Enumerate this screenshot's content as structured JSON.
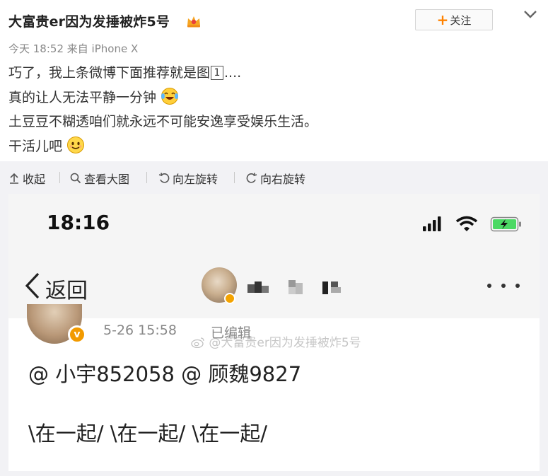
{
  "post": {
    "username": "大富贵er因为发捶被炸5号",
    "follow_label": "关注",
    "follow_plus": "+",
    "time": "今天 18:52",
    "source": "来自 iPhone X",
    "lines": {
      "line1_before": "巧了，我上条微博下面推荐就是图",
      "line1_boxed": "1",
      "line1_after": "....",
      "line2": "真的让人无法平静一分钟",
      "line3": "土豆豆不糊透咱们就永远不可能安逸享受娱乐生活。",
      "line4": "干活儿吧"
    }
  },
  "toolbar": {
    "collapse": "收起",
    "view_large": "查看大图",
    "rotate_left": "向左旋转",
    "rotate_right": "向右旋转"
  },
  "screenshot": {
    "status_time": "18:16",
    "back_label": "返回",
    "card": {
      "date": "5-26 15:58",
      "edited": "已编辑",
      "watermark": "@大富贵er因为发捶被炸5号",
      "mentions": "@ 小宇852058 @ 顾魏9827",
      "together": "\\在一起/ \\在一起/ \\在一起/",
      "v_badge": "v"
    }
  },
  "colors": {
    "accent_orange": "#ff8200",
    "verified_badge": "#f29a00",
    "battery_green": "#4cd964",
    "toolbar_bg": "#f2f2f5"
  },
  "icons": [
    "crown-badge-icon",
    "chevron-down-icon",
    "laugh-cry-emoji-icon",
    "smile-emoji-icon",
    "collapse-arrow-icon",
    "search-icon",
    "rotate-left-icon",
    "rotate-right-icon",
    "signal-icon",
    "wifi-icon",
    "battery-icon",
    "back-chevron-icon",
    "more-dots-icon",
    "weibo-logo-icon"
  ]
}
